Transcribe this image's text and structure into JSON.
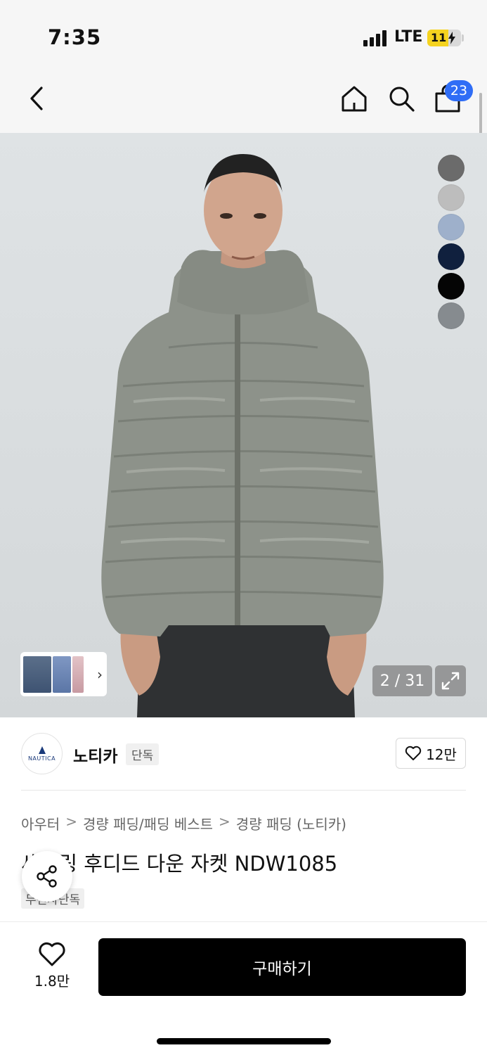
{
  "status_bar": {
    "time": "7:35",
    "network": "LTE",
    "battery": "11"
  },
  "nav": {
    "icons": [
      "chevron-left-icon",
      "home-icon",
      "search-icon",
      "shopping-bag-icon"
    ],
    "cart_count": "23"
  },
  "gallery": {
    "counter": "2 / 31",
    "current_index": 2,
    "total": 31,
    "swatches": [
      "#6b6b6b",
      "#bdbdbd",
      "#9eb0cb",
      "#10203e",
      "#050505",
      "#868b8f"
    ]
  },
  "brand": {
    "logo_text": "NAUTICA",
    "name": "노티카",
    "tag": "단독",
    "likes": "12만"
  },
  "breadcrumb": [
    "아우터",
    "경량 패딩/패딩 베스트",
    "경량 패딩 (노티카)"
  ],
  "breadcrumb_separator": ">",
  "product": {
    "title": "세일링 후디드 다운 자켓 NDW1085",
    "tag": "무신사단독"
  },
  "bottom": {
    "wish_count": "1.8만",
    "buy_label": "구매하기"
  }
}
